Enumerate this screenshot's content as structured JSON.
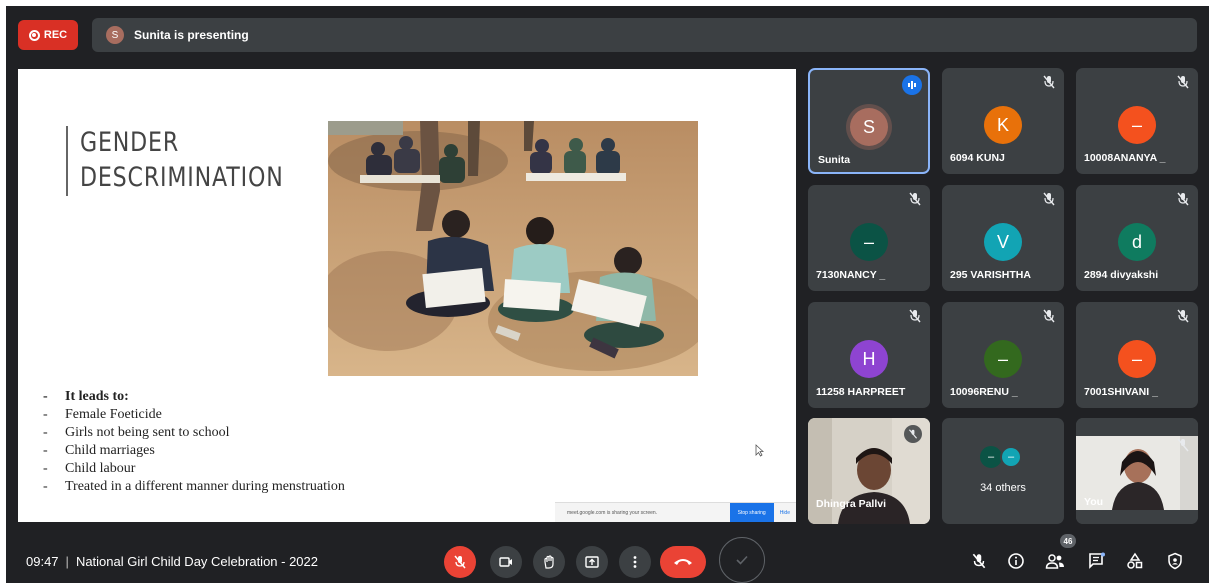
{
  "top_bar": {
    "rec_label": "REC",
    "presenter_initial": "S",
    "presenting_text": "Sunita is presenting"
  },
  "slide": {
    "title_line1": "GENDER",
    "title_line2": "DESCRIMINATION",
    "list_heading": "It leads to:",
    "bullets": [
      "Female Foeticide",
      "Girls not being sent to school",
      "Child marriages",
      "Child labour",
      "Treated in a different manner during menstruation"
    ],
    "share_text": "meet.google.com is sharing your screen.",
    "stop_sharing_label": "Stop sharing",
    "hide_label": "Hide"
  },
  "participants": [
    {
      "initial": "S",
      "name": "Sunita",
      "color": "#a86d5f",
      "speaking": true
    },
    {
      "initial": "K",
      "name": "6094 KUNJ",
      "color": "#e8710a",
      "muted": true
    },
    {
      "initial": "–",
      "name": "10008ANANYA _",
      "color": "#f4511e",
      "muted": true
    },
    {
      "initial": "–",
      "name": "7130NANCY _",
      "color": "#0b5345",
      "muted": true
    },
    {
      "initial": "V",
      "name": "295 VARISHTHA",
      "color": "#12a4b4",
      "muted": true
    },
    {
      "initial": "d",
      "name": "2894 divyakshi",
      "color": "#0f7b5f",
      "muted": true
    },
    {
      "initial": "H",
      "name": "11258 HARPREET",
      "color": "#8e44d1",
      "muted": true
    },
    {
      "initial": "–",
      "name": "10096RENU _",
      "color": "#33691e",
      "muted": true
    },
    {
      "initial": "–",
      "name": "7001SHIVANI _",
      "color": "#f4511e",
      "muted": true
    },
    {
      "name": "Dhingra Pallvi",
      "video": true,
      "muted": true
    },
    {
      "name": "34 others",
      "group": true,
      "colors": [
        "#0b5345",
        "#12a4b4"
      ]
    },
    {
      "name": "You",
      "video": true,
      "muted": true
    }
  ],
  "bottom_bar": {
    "time": "09:47",
    "meeting_title": "National Girl Child Day Celebration - 2022",
    "people_count": "46"
  },
  "icons": {
    "rec": "record-icon",
    "mic_off": "mic-off-icon",
    "camera": "camera-icon",
    "raise_hand": "hand-icon",
    "present": "present-icon",
    "more": "more-vert-icon",
    "end": "call-end-icon",
    "check": "check-icon",
    "info": "info-icon",
    "people": "people-icon",
    "chat": "chat-icon",
    "activities": "activities-icon",
    "host_controls": "shield-icon"
  },
  "colors": {
    "background": "#202124",
    "tile": "#3c4043",
    "red": "#ea4335",
    "blue": "#1a73e8"
  }
}
